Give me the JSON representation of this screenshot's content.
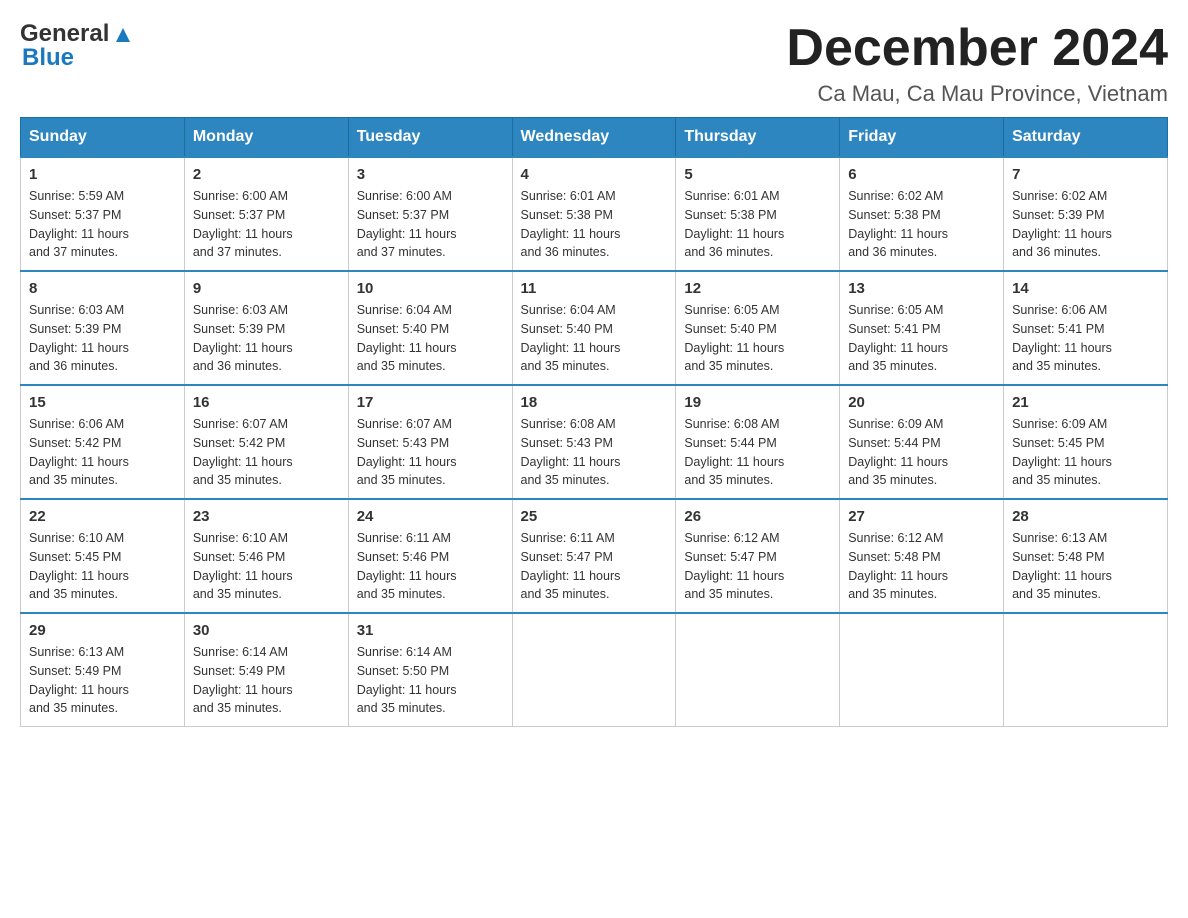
{
  "header": {
    "logo_line1": "General",
    "logo_line2": "Blue",
    "month_title": "December 2024",
    "location": "Ca Mau, Ca Mau Province, Vietnam"
  },
  "weekdays": [
    "Sunday",
    "Monday",
    "Tuesday",
    "Wednesday",
    "Thursday",
    "Friday",
    "Saturday"
  ],
  "weeks": [
    [
      {
        "day": "1",
        "sunrise": "5:59 AM",
        "sunset": "5:37 PM",
        "daylight": "11 hours and 37 minutes."
      },
      {
        "day": "2",
        "sunrise": "6:00 AM",
        "sunset": "5:37 PM",
        "daylight": "11 hours and 37 minutes."
      },
      {
        "day": "3",
        "sunrise": "6:00 AM",
        "sunset": "5:37 PM",
        "daylight": "11 hours and 37 minutes."
      },
      {
        "day": "4",
        "sunrise": "6:01 AM",
        "sunset": "5:38 PM",
        "daylight": "11 hours and 36 minutes."
      },
      {
        "day": "5",
        "sunrise": "6:01 AM",
        "sunset": "5:38 PM",
        "daylight": "11 hours and 36 minutes."
      },
      {
        "day": "6",
        "sunrise": "6:02 AM",
        "sunset": "5:38 PM",
        "daylight": "11 hours and 36 minutes."
      },
      {
        "day": "7",
        "sunrise": "6:02 AM",
        "sunset": "5:39 PM",
        "daylight": "11 hours and 36 minutes."
      }
    ],
    [
      {
        "day": "8",
        "sunrise": "6:03 AM",
        "sunset": "5:39 PM",
        "daylight": "11 hours and 36 minutes."
      },
      {
        "day": "9",
        "sunrise": "6:03 AM",
        "sunset": "5:39 PM",
        "daylight": "11 hours and 36 minutes."
      },
      {
        "day": "10",
        "sunrise": "6:04 AM",
        "sunset": "5:40 PM",
        "daylight": "11 hours and 35 minutes."
      },
      {
        "day": "11",
        "sunrise": "6:04 AM",
        "sunset": "5:40 PM",
        "daylight": "11 hours and 35 minutes."
      },
      {
        "day": "12",
        "sunrise": "6:05 AM",
        "sunset": "5:40 PM",
        "daylight": "11 hours and 35 minutes."
      },
      {
        "day": "13",
        "sunrise": "6:05 AM",
        "sunset": "5:41 PM",
        "daylight": "11 hours and 35 minutes."
      },
      {
        "day": "14",
        "sunrise": "6:06 AM",
        "sunset": "5:41 PM",
        "daylight": "11 hours and 35 minutes."
      }
    ],
    [
      {
        "day": "15",
        "sunrise": "6:06 AM",
        "sunset": "5:42 PM",
        "daylight": "11 hours and 35 minutes."
      },
      {
        "day": "16",
        "sunrise": "6:07 AM",
        "sunset": "5:42 PM",
        "daylight": "11 hours and 35 minutes."
      },
      {
        "day": "17",
        "sunrise": "6:07 AM",
        "sunset": "5:43 PM",
        "daylight": "11 hours and 35 minutes."
      },
      {
        "day": "18",
        "sunrise": "6:08 AM",
        "sunset": "5:43 PM",
        "daylight": "11 hours and 35 minutes."
      },
      {
        "day": "19",
        "sunrise": "6:08 AM",
        "sunset": "5:44 PM",
        "daylight": "11 hours and 35 minutes."
      },
      {
        "day": "20",
        "sunrise": "6:09 AM",
        "sunset": "5:44 PM",
        "daylight": "11 hours and 35 minutes."
      },
      {
        "day": "21",
        "sunrise": "6:09 AM",
        "sunset": "5:45 PM",
        "daylight": "11 hours and 35 minutes."
      }
    ],
    [
      {
        "day": "22",
        "sunrise": "6:10 AM",
        "sunset": "5:45 PM",
        "daylight": "11 hours and 35 minutes."
      },
      {
        "day": "23",
        "sunrise": "6:10 AM",
        "sunset": "5:46 PM",
        "daylight": "11 hours and 35 minutes."
      },
      {
        "day": "24",
        "sunrise": "6:11 AM",
        "sunset": "5:46 PM",
        "daylight": "11 hours and 35 minutes."
      },
      {
        "day": "25",
        "sunrise": "6:11 AM",
        "sunset": "5:47 PM",
        "daylight": "11 hours and 35 minutes."
      },
      {
        "day": "26",
        "sunrise": "6:12 AM",
        "sunset": "5:47 PM",
        "daylight": "11 hours and 35 minutes."
      },
      {
        "day": "27",
        "sunrise": "6:12 AM",
        "sunset": "5:48 PM",
        "daylight": "11 hours and 35 minutes."
      },
      {
        "day": "28",
        "sunrise": "6:13 AM",
        "sunset": "5:48 PM",
        "daylight": "11 hours and 35 minutes."
      }
    ],
    [
      {
        "day": "29",
        "sunrise": "6:13 AM",
        "sunset": "5:49 PM",
        "daylight": "11 hours and 35 minutes."
      },
      {
        "day": "30",
        "sunrise": "6:14 AM",
        "sunset": "5:49 PM",
        "daylight": "11 hours and 35 minutes."
      },
      {
        "day": "31",
        "sunrise": "6:14 AM",
        "sunset": "5:50 PM",
        "daylight": "11 hours and 35 minutes."
      },
      null,
      null,
      null,
      null
    ]
  ],
  "labels": {
    "sunrise": "Sunrise:",
    "sunset": "Sunset:",
    "daylight": "Daylight:"
  }
}
